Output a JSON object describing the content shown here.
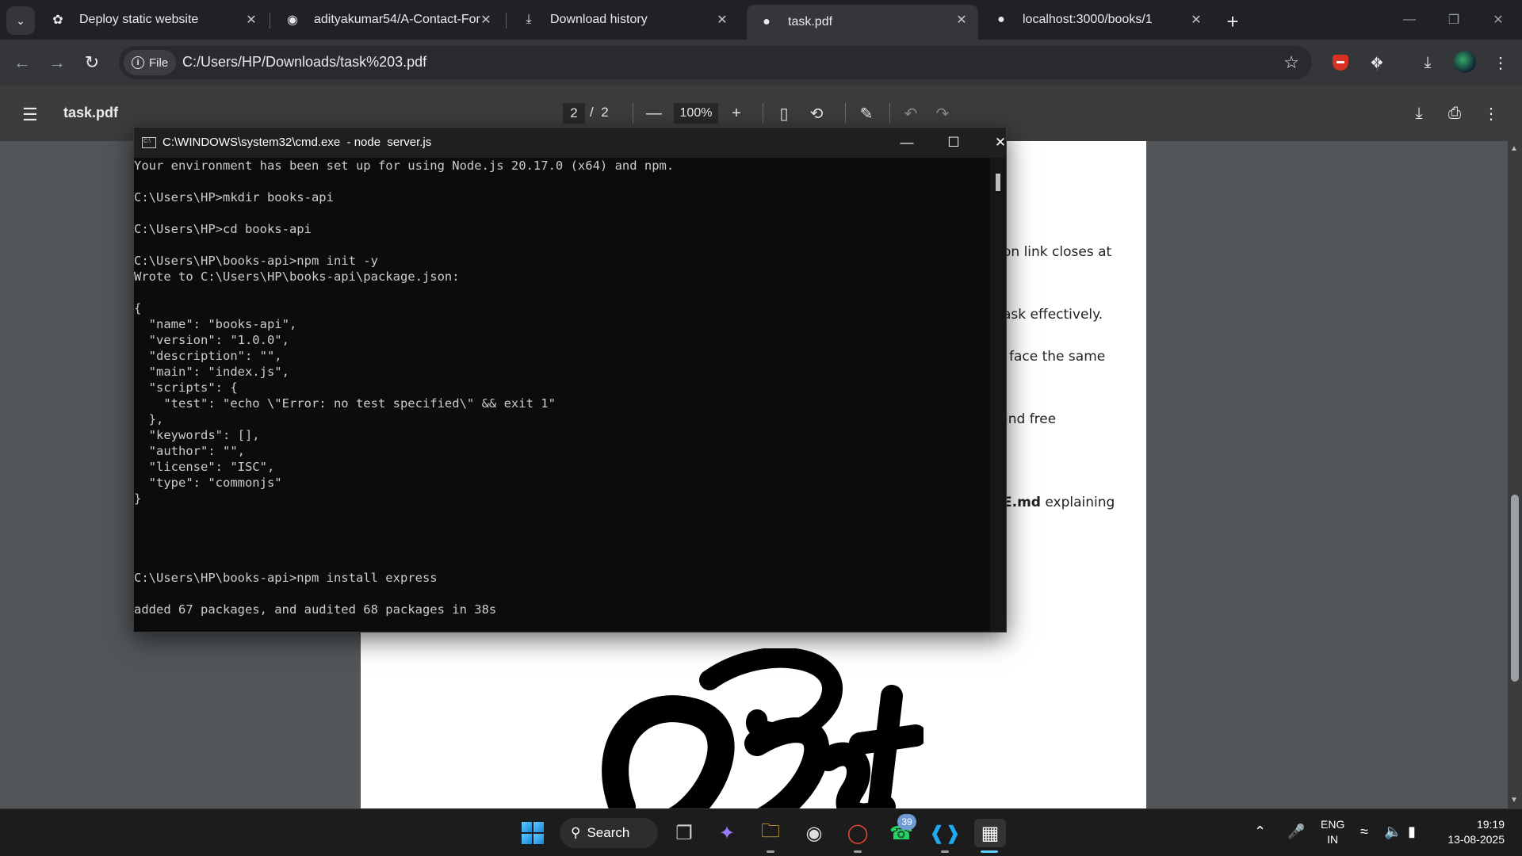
{
  "browser": {
    "tabs": [
      {
        "label": "Deploy static website",
        "icon": "openai-icon"
      },
      {
        "label": "adityakumar54/A-Contact-Form",
        "icon": "github-icon"
      },
      {
        "label": "Download history",
        "icon": "download-icon"
      },
      {
        "label": "task.pdf",
        "icon": "globe-icon",
        "active": true
      },
      {
        "label": "localhost:3000/books/1",
        "icon": "globe-icon"
      }
    ],
    "address": {
      "chip_label": "File",
      "url": "C:/Users/HP/Downloads/task%203.pdf"
    }
  },
  "pdf_viewer": {
    "title": "task.pdf",
    "current_page": "2",
    "total_pages": "2",
    "page_separator": "/",
    "zoom": "100%",
    "visible_lines": [
      "on link closes at",
      "ask effectively.",
      "face the same",
      "ind free"
    ],
    "bold_fragment": "E.md",
    "bold_suffix": " explaining",
    "artwork_text": "Best"
  },
  "cmd_window": {
    "title": "C:\\WINDOWS\\system32\\cmd.exe  - node  server.js",
    "lines": [
      "Your environment has been set up for using Node.js 20.17.0 (x64) and npm.",
      "",
      "C:\\Users\\HP>mkdir books-api",
      "",
      "C:\\Users\\HP>cd books-api",
      "",
      "C:\\Users\\HP\\books-api>npm init -y",
      "Wrote to C:\\Users\\HP\\books-api\\package.json:",
      "",
      "{",
      "  \"name\": \"books-api\",",
      "  \"version\": \"1.0.0\",",
      "  \"description\": \"\",",
      "  \"main\": \"index.js\",",
      "  \"scripts\": {",
      "    \"test\": \"echo \\\"Error: no test specified\\\" && exit 1\"",
      "  },",
      "  \"keywords\": [],",
      "  \"author\": \"\",",
      "  \"license\": \"ISC\",",
      "  \"type\": \"commonjs\"",
      "}",
      "",
      "",
      "",
      "",
      "C:\\Users\\HP\\books-api>npm install express",
      "",
      "added 67 packages, and audited 68 packages in 38s"
    ]
  },
  "taskbar": {
    "search_label": "Search",
    "whatsapp_badge": "39",
    "language": "ENG",
    "region": "IN",
    "time": "19:19",
    "date": "13-08-2025"
  }
}
